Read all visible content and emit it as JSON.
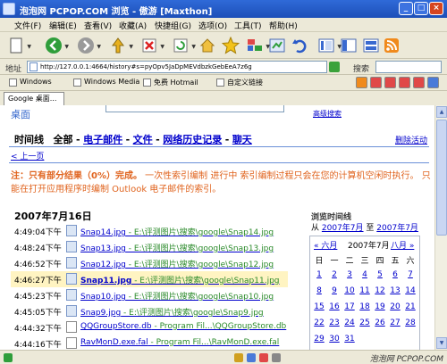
{
  "window": {
    "title": "泡泡网 PCPOP.COM 浏览 - 傲游 [Maxthon]",
    "minimize": "_",
    "maximize": "□",
    "close": "×"
  },
  "menu": [
    "文件(F)",
    "编辑(E)",
    "查看(V)",
    "收藏(A)",
    "快捷组(G)",
    "选项(O)",
    "工具(T)",
    "帮助(H)"
  ],
  "address": {
    "label": "地址",
    "url": "http://127.0.0.1:4664/history#s=pyOpv5JaDpMEVdbzkGebEeA7z6g",
    "search_label": "搜索"
  },
  "links": [
    "Windows",
    "Windows Media",
    "免费 Hotmail",
    "自定义链接"
  ],
  "tab": {
    "label": "Google 桌面..."
  },
  "page": {
    "logo_text": "桌面",
    "advanced_search": "高级搜索",
    "nav": {
      "current_label": "时间线",
      "all": "全部",
      "items": [
        "电子邮件",
        "文件",
        "网络历史记录",
        "聊天"
      ],
      "separator": "-"
    },
    "delete_activity": "删除活动",
    "prev_page": "< 上一页",
    "notice_bold": "注：只有部分结果（0%）完成。",
    "notice_text": "一次性索引编制 进行中 索引编制过程只会在您的计算机空闲时执行。 只能在打开应用程序时编制 Outlook 电子邮件的索引。",
    "date_heading": "2007年7月16日",
    "rows": [
      {
        "time": "4:49:04下午",
        "name": "Snap14.jpg",
        "path": " - E:\\评测图片\\搜索\\google\\Snap14.jpg"
      },
      {
        "time": "4:48:24下午",
        "name": "Snap13.jpg",
        "path": " - E:\\评测图片\\搜索\\google\\Snap13.jpg"
      },
      {
        "time": "4:46:52下午",
        "name": "Snap12.jpg",
        "path": " - E:\\评测图片\\搜索\\google\\Snap12.jpg"
      },
      {
        "time": "4:46:27下午",
        "name": "Snap11.jpg",
        "path": " - E:\\评测图片\\搜索\\google\\Snap11.jpg"
      },
      {
        "time": "4:45:23下午",
        "name": "Snap10.jpg",
        "path": " - E:\\评测图片\\搜索\\google\\Snap10.jpg"
      },
      {
        "time": "4:45:05下午",
        "name": "Snap9.jpg",
        "path": " - E:\\评测图片\\搜索\\google\\Snap9.jpg"
      },
      {
        "time": "4:44:32下午",
        "name": "QQGroupStore.db",
        "path": " - Program Fil...\\QQGroupStore.db"
      },
      {
        "time": "4:44:16下午",
        "name": "RavMonD.exe.fal",
        "path": " - Program Fil...\\RavMonD.exe.fal"
      }
    ],
    "highlight_row": 3
  },
  "sidebar": {
    "title": "浏览时间线",
    "from": "从",
    "from_link": "2007年7月",
    "to": "至",
    "to_link": "2007年7月",
    "calendar": {
      "prev": "« 六月",
      "month": "2007年7月",
      "next": "八月 »",
      "weekdays": [
        "日",
        "一",
        "二",
        "三",
        "四",
        "五",
        "六"
      ],
      "weeks": [
        [
          "1",
          "2",
          "3",
          "4",
          "5",
          "6",
          "7"
        ],
        [
          "8",
          "9",
          "10",
          "11",
          "12",
          "13",
          "14"
        ],
        [
          "15",
          "16",
          "17",
          "18",
          "19",
          "20",
          "21"
        ],
        [
          "22",
          "23",
          "24",
          "25",
          "26",
          "27",
          "28"
        ],
        [
          "29",
          "30",
          "31",
          "",
          "",
          "",
          ""
        ]
      ]
    }
  },
  "status": {
    "watermark": "泡泡网 PCPOP.COM"
  }
}
